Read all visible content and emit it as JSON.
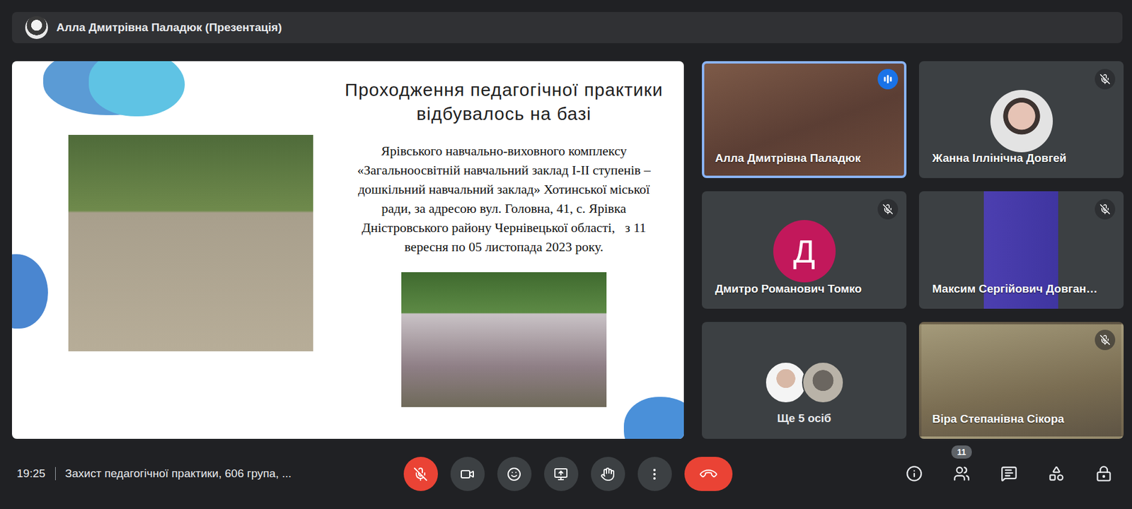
{
  "presenter_bar": {
    "name": "Алла Дмитрівна Паладюк (Презентація)"
  },
  "slide": {
    "title_lines": [
      "Проходження педагогічної практики",
      "відбувалось на базі"
    ],
    "body_lines": [
      "Ярівського навчально-виховного комплексу",
      "«Загальноосвітній навчальний заклад І-ІІ ступенів –",
      "дошкільний навчальний заклад» Хотинської міської",
      "ради, за адресою вул. Головна, 41, с. Ярівка",
      "Дністровського району Чернівецької області,   з 11",
      "вересня по 05 листопада 2023 року."
    ]
  },
  "tiles": [
    {
      "kind": "video",
      "name": "Алла Дмитрівна Паладюк",
      "speaking": true,
      "muted": false
    },
    {
      "kind": "photo-avatar",
      "name": "Жанна Іллінічна Довгей",
      "speaking": false,
      "muted": true
    },
    {
      "kind": "letter-avatar",
      "name": "Дмитро Романович Томко",
      "letter": "Д",
      "color": "#c2185b",
      "speaking": false,
      "muted": true
    },
    {
      "kind": "video-narrow",
      "name": "Максим Сергійович Довган…",
      "speaking": false,
      "muted": true
    },
    {
      "kind": "others",
      "label": "Ще 5 осіб",
      "speaking": false,
      "muted": false
    },
    {
      "kind": "video",
      "name": "Віра Степанівна Сікора",
      "speaking": false,
      "muted": true
    }
  ],
  "bottom_bar": {
    "time": "19:25",
    "meeting_title": "Захист педагогічної практики, 606 група, ...",
    "mic_muted": true,
    "participants_count": "11"
  }
}
